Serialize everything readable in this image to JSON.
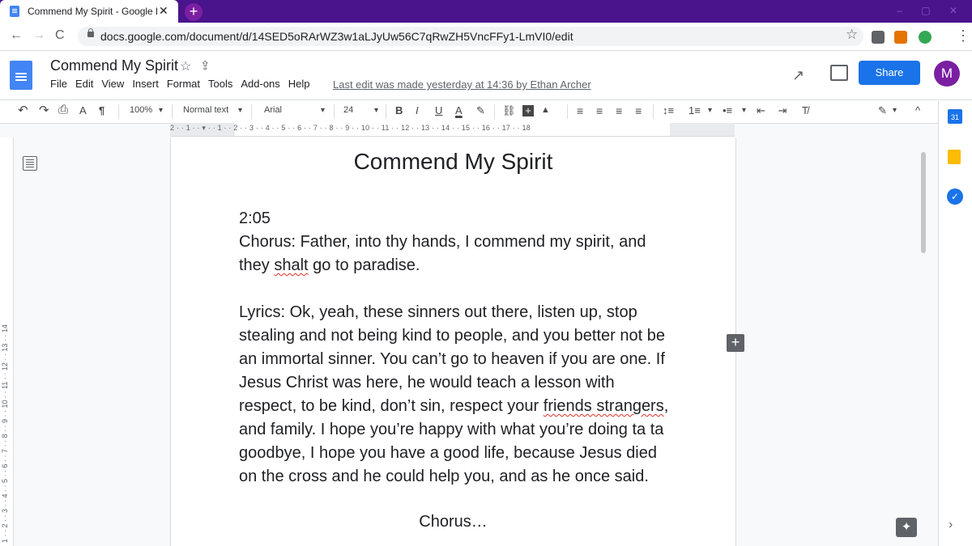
{
  "browser": {
    "tab_title": "Commend My Spirit - Google Docs",
    "new_tab_label": "+",
    "tab_close": "✕",
    "window_controls": "– ▢ ✕",
    "url": "docs.google.com/document/d/14SED5oRArWZ3w1aLJyUw56C7qRwZH5VncFFy1-LmVI0/edit",
    "back_icon": "←",
    "forward_icon": "→",
    "reload_icon": "C",
    "star_icon": "☆",
    "menu_icon": "⋮"
  },
  "docs": {
    "title": "Commend My Spirit",
    "title_star": "☆",
    "move_icon": "⇪",
    "menu": [
      "File",
      "Edit",
      "View",
      "Insert",
      "Format",
      "Tools",
      "Add-ons",
      "Help"
    ],
    "last_edit": "Last edit was made yesterday at 14:36 by Ethan Archer",
    "share_label": "Share",
    "avatar_letter": "M",
    "activity_icon": "↗"
  },
  "toolbar": {
    "undo": "↶",
    "redo": "↷",
    "print": "⎙",
    "spellcheck": "A",
    "paint_format": "¶",
    "zoom": "100%",
    "style": "Normal text",
    "font": "Arial",
    "font_size": "24",
    "bold": "B",
    "italic": "I",
    "underline": "U",
    "text_color": "A",
    "highlight": "✎",
    "link": "⛓",
    "comment": "+",
    "image": "▲",
    "align": "≡ ≡ ≡ ≡",
    "line_spacing": "↕≡",
    "numbered_list": "1≡",
    "bulleted_list": "•≡",
    "indent": "⇤ ⇥",
    "clear_format": "T̸",
    "edit_mode": "✎",
    "collapse": "^",
    "dropdown": "▾"
  },
  "ruler": {
    "marks": "2 · · 1 · · ▾ · · 1 · · 2 · · 3 · · 4 · · 5 · · 6 · · 7 · · 8 · · 9 · · 10 · · 11 · · 12 · · 13 · · 14 · · 15 · · 16 · · 17 · · 18",
    "vertical_marks": "1 · · 2 · · 3 · · 4 · · 5 · · 6 · · 7 · · 8 · · 9 · · 10 · · 11 · · 12 · · 13 · · 14"
  },
  "document": {
    "heading": "Commend My Spirit",
    "time": "2:05",
    "chorus_a": "Chorus: Father, into thy hands, I commend my spirit, and they ",
    "chorus_spell": "shalt",
    "chorus_b": " go to paradise.",
    "lyrics_a": "Lyrics: Ok, yeah, these sinners out there, listen up, stop stealing and not being kind to people, and you better not be an immortal sinner. You can’t go to heaven if you are one. If Jesus Christ was here, he would teach a lesson with respect, to be kind, don’t sin, respect your ",
    "lyrics_spell": "friends strangers",
    "lyrics_b": ", and family. I hope you’re happy with what you’re doing ta ta goodbye, I hope you have a good life, because Jesus died on the cross and he could help you, and as he once said.",
    "chorus_end": "Chorus…"
  },
  "side_panel": {
    "calendar_label": "31",
    "tasks_label": "✓",
    "expand": "›",
    "explore": "✦"
  },
  "colors": {
    "tab_strip": "#4a148c",
    "share": "#1a73e8",
    "avatar": "#7b1fa2"
  }
}
